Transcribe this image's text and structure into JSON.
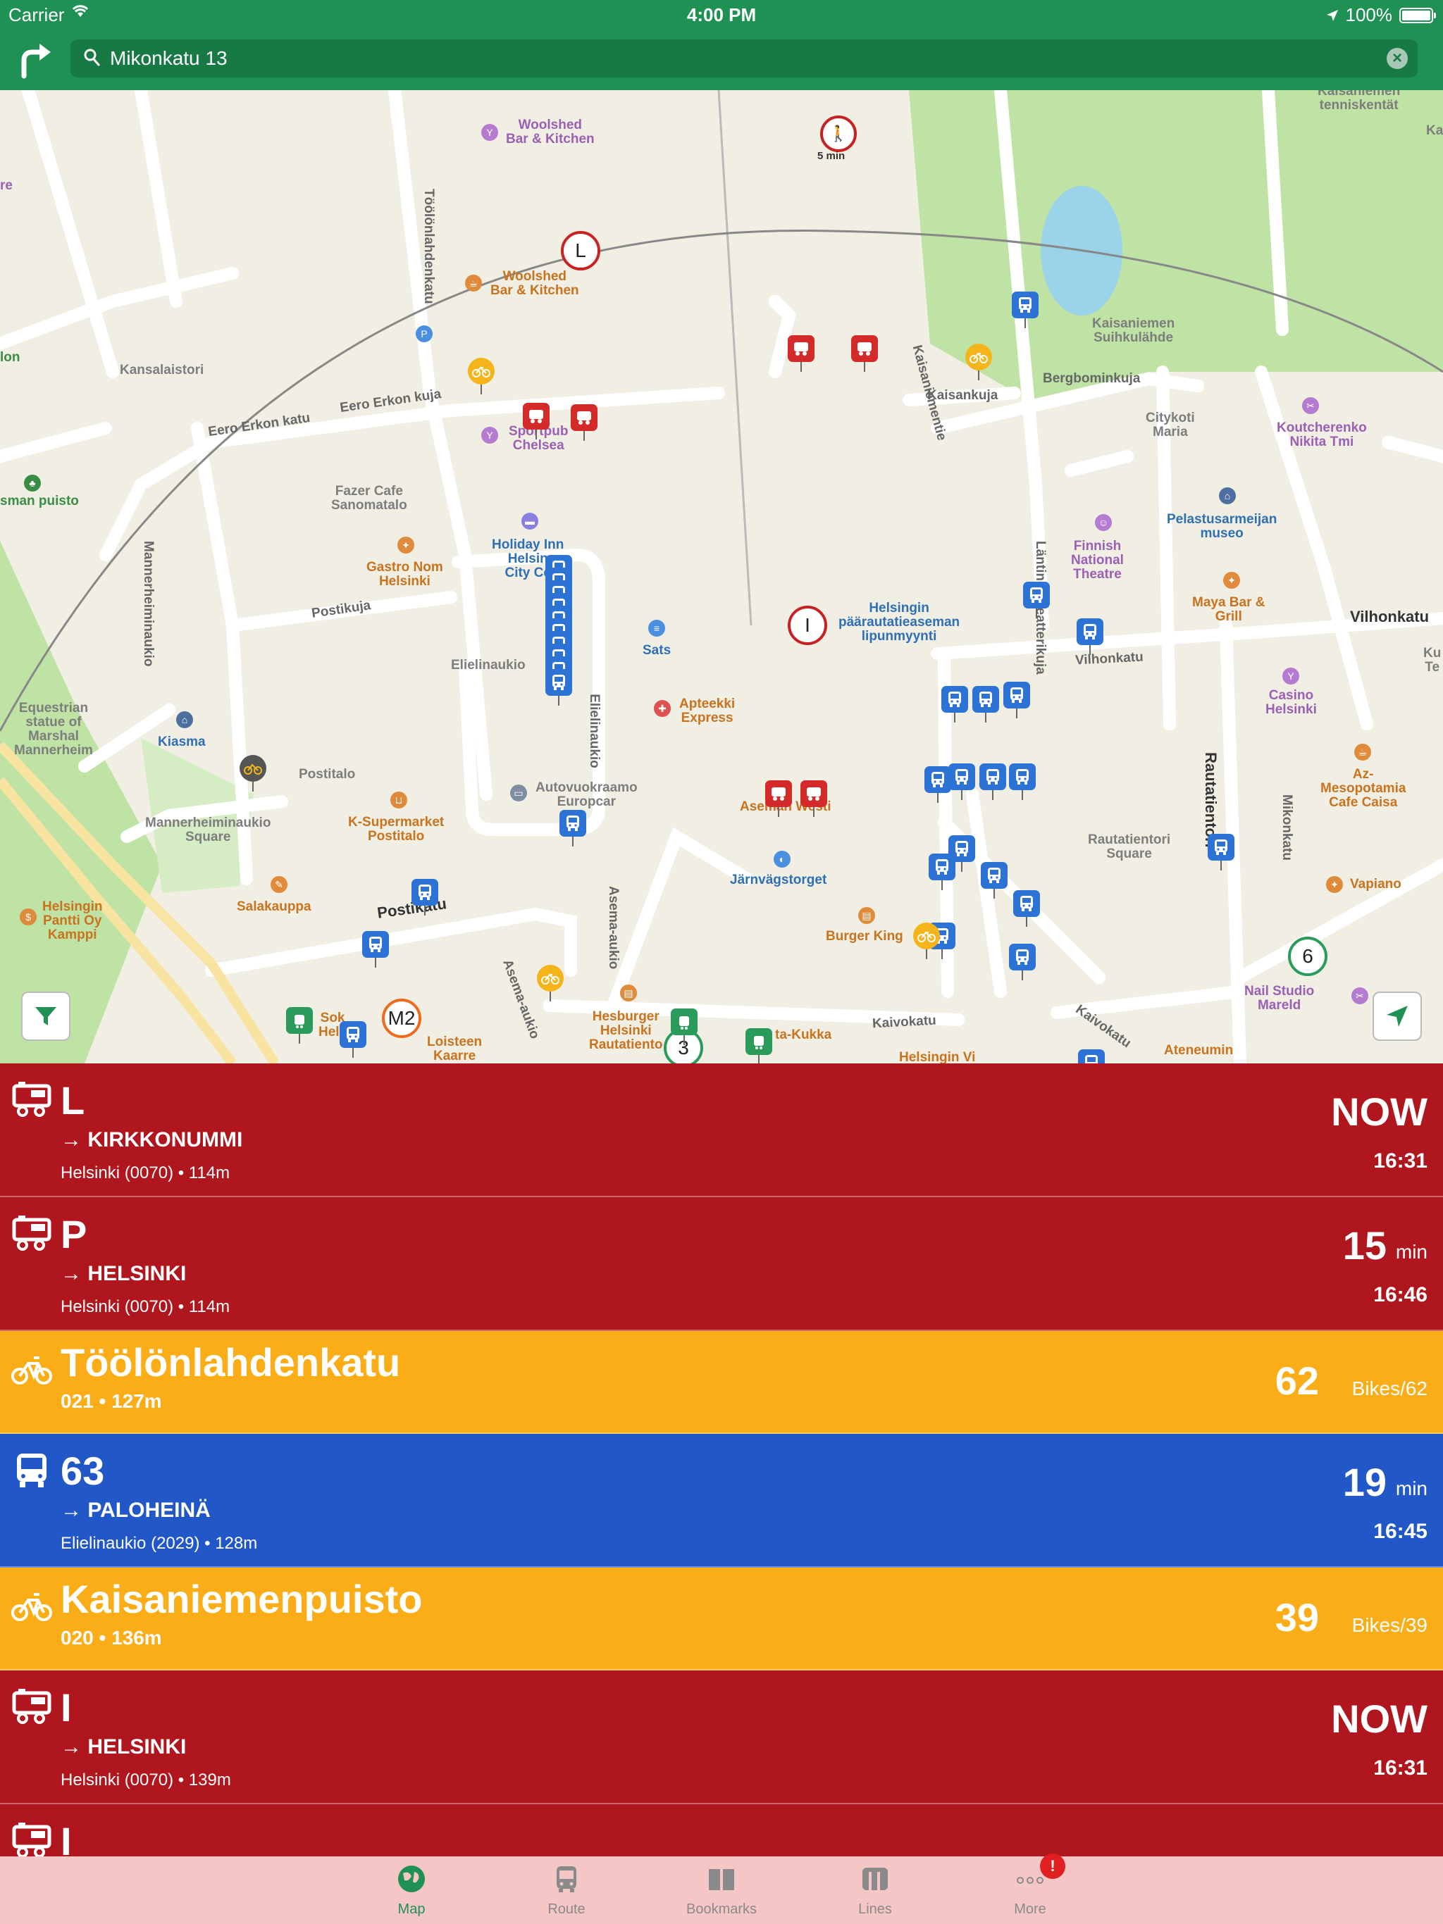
{
  "status_bar": {
    "carrier": "Carrier",
    "time": "4:00 PM",
    "battery": "100%"
  },
  "search": {
    "value": "Mikonkatu 13",
    "placeholder": ""
  },
  "map": {
    "labels": {
      "woolshed_top": "Woolshed\nBar & Kitchen",
      "woolshed": "Woolshed\nBar & Kitchen",
      "kansalaistori": "Kansalaistori",
      "eero_erkon_katu": "Eero Erkon katu",
      "eero_erkon_kuja": "Eero Erkon kuja",
      "sportpub": "Sportpub\nChelsea",
      "fazer": "Fazer Cafe\nSanomatalo",
      "gastro": "Gastro Nom\nHelsinki",
      "holiday": "Holiday Inn\nHelsin\nCity Ce",
      "postikuja": "Postikuja",
      "elielinaukio": "Elielinaukio",
      "elielinaukio_v": "Elielinaukio",
      "sats": "Sats",
      "apteekki": "Apteekki\nExpress",
      "kiasma": "Kiasma",
      "postitalo": "Postitalo",
      "equestrian": "Equestrian\nstatue of\nMarshal\nMannerheim",
      "autovuokraamo": "Autovuokraamo\nEuropcar",
      "ksupermarket": "K-Supermarket\nPostitalo",
      "mannerheiminaukio_sq": "Mannerheiminaukio\nSquare",
      "mannerheiminaukio": "Mannerheiminaukio",
      "asema": "Aseman Westi",
      "jarnvagstorget": "Järnvägstorget",
      "burger": "Burger King",
      "salakauppa": "Salakauppa",
      "pantti": "Helsingin\nPantti Oy\nKamppi",
      "postikatu": "Postikatu",
      "hesburger": "Hesburger\nHelsinki\nRautatiento",
      "loisteen": "Loisteen\nKaarre",
      "kaivokatu": "Kaivokatu",
      "kaivokatu2": "Kaivokatu",
      "ateneumin": "Ateneumin",
      "kaisaniemen_tennis": "Kaisaniemen\ntenniskentät",
      "kaisaniementie": "Kaisaniementie",
      "kaisaniemen_sk": "Kaisaniemen\nSuihkulähde",
      "kaisankuja": "Kaisankuja",
      "bergbominkuja": "Bergbominkuja",
      "citykoti": "Citykoti\nMaria",
      "koutcherenko": "Koutcherenko\nNikita Tmi",
      "pelastus": "Pelastusarmeijan\nmuseo",
      "finnish": "Finnish\nNational\nTheatre",
      "lantinen": "Läntinen Teatterikuja",
      "lipunmyynti": "Helsingin\npäärautatieaseman\nlipunmyynti",
      "maya": "Maya Bar &\nGrill",
      "vilhonkatu": "Vilhonkatu",
      "vilhonkatu_small": "Vilhonkatu",
      "casino": "Casino\nHelsinki",
      "az": "Az-\nMesopotamia\nCafe Caisa",
      "rautatientori_sq": "Rautatientori\nSquare",
      "rautatientori": "Rautatientori",
      "mikonkatu": "Mikonkatu",
      "vapiano": "Vapiano",
      "nail": "Nail Studio\nMareld",
      "toolonlahdenkatu": "Töölönlahdenkatu",
      "asema_aukio": "Asema-aukio",
      "asema_aukio2": "Asema-aukio",
      "helsingin_vi": "Helsingin Vi",
      "sokos": "Sok\nHels",
      "kukka": "ta-Kukka",
      "man_puisto": "sman puisto",
      "lon": "lon",
      "re": "re",
      "ku": "Ku\nTe",
      "ka": "Ka"
    },
    "walk_marker": "5 min",
    "markers": {
      "l": "L",
      "i": "I",
      "m2": "M2",
      "three": "3",
      "six": "6"
    },
    "accent_colors": {
      "train": "#d42a2a",
      "bus": "#2d73d6",
      "bike": "#f4b41a",
      "tram": "#2a9b5a",
      "metro": "#f06a1c"
    }
  },
  "departures": [
    {
      "type": "train",
      "title": "L",
      "dest": "→ KIRKKONUMMI",
      "sub": "Helsinki (0070) • 114m",
      "big": "NOW",
      "unit": "",
      "clock": "16:31"
    },
    {
      "type": "train",
      "title": "P",
      "dest": "→ HELSINKI",
      "sub": "Helsinki (0070) • 114m",
      "big": "15",
      "unit": "min",
      "clock": "16:46"
    },
    {
      "type": "bike",
      "title": "Töölönlahdenkatu",
      "dest": "",
      "sub": "021 • 127m",
      "big": "62",
      "unit": "Bikes/62",
      "clock": ""
    },
    {
      "type": "bus",
      "title": "63",
      "dest": "→ PALOHEINÄ",
      "sub": "Elielinaukio (2029) • 128m",
      "big": "19",
      "unit": "min",
      "clock": "16:45"
    },
    {
      "type": "bike",
      "title": "Kaisaniemenpuisto",
      "dest": "",
      "sub": "020 • 136m",
      "big": "39",
      "unit": "Bikes/39",
      "clock": ""
    },
    {
      "type": "train",
      "title": "I",
      "dest": "→ HELSINKI",
      "sub": "Helsinki (0070) • 139m",
      "big": "NOW",
      "unit": "",
      "clock": "16:31"
    },
    {
      "type": "train",
      "title": "I",
      "dest": "",
      "sub": "",
      "big": "",
      "unit": "",
      "clock": ""
    }
  ],
  "tabs": [
    {
      "label": "Map",
      "icon": "globe-icon",
      "active": true
    },
    {
      "label": "Route",
      "icon": "bus-icon",
      "active": false
    },
    {
      "label": "Bookmarks",
      "icon": "book-icon",
      "active": false
    },
    {
      "label": "Lines",
      "icon": "lines-icon",
      "active": false
    },
    {
      "label": "More",
      "icon": "more-icon",
      "active": false
    }
  ],
  "more_badge": "!"
}
